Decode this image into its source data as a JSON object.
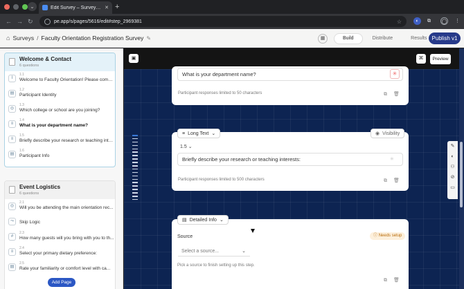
{
  "browser": {
    "tab_title": "Edit Survey – Survey Everywh",
    "tab_close": "✕",
    "new_tab": "+",
    "url": "pe.app/s/pages/5616/edit#step_2969381",
    "icons": {
      "back": "arrow-left-icon",
      "forward": "arrow-right-icon",
      "reload": "reload-icon",
      "star": "star-icon",
      "extensions": "puzzle-icon",
      "profile": "profile-icon",
      "menu": "more-vert-icon"
    }
  },
  "header": {
    "surveys_label": "Surveys",
    "separator": "/",
    "survey_title": "Faculty Orientation Registration Survey",
    "tabs": [
      {
        "label": "Build",
        "active": true
      },
      {
        "label": "Distribute",
        "active": false
      },
      {
        "label": "Results",
        "active": false
      }
    ],
    "publish_label": "Publish v1"
  },
  "sidebar": {
    "pages": [
      {
        "title": "Welcome & Contact",
        "count": "6 questions",
        "questions": [
          {
            "num": "1.1",
            "text": "Welcome to Faculty Orientation! Please comp...",
            "icon": "I"
          },
          {
            "num": "1.2",
            "text": "Participant Identity",
            "icon": "▤"
          },
          {
            "num": "1.3",
            "text": "Which college or school are you joining?",
            "icon": "◎"
          },
          {
            "num": "1.4",
            "text": "What is your department name?",
            "icon": "≡",
            "selected": true
          },
          {
            "num": "1.5",
            "text": "Briefly describe your research or teaching inte...",
            "icon": "≡"
          },
          {
            "num": "1.6",
            "text": "Participant Info",
            "icon": "▤"
          }
        ]
      },
      {
        "title": "Event Logistics",
        "count": "6 questions",
        "questions": [
          {
            "num": "2.1",
            "text": "Will you be attending the main orientation rec...",
            "icon": "◎"
          },
          {
            "text": "Skip Logic",
            "icon": "⤳"
          },
          {
            "num": "2.3",
            "text": "How many guests will you bring with you to th...",
            "icon": "#"
          },
          {
            "num": "2.4",
            "text": "Select your primary dietary preference:",
            "icon": "≡"
          },
          {
            "num": "2.5",
            "text": "Rate your familiarity or comfort level with ca...",
            "icon": "▤"
          }
        ]
      }
    ],
    "add_page": "Add Page"
  },
  "canvas": {
    "preview_label": "Preview",
    "card1": {
      "input_text": "What is your department name?",
      "hint": "Participant responses limited to 50 characters"
    },
    "card2": {
      "type_label": "Long Text",
      "visibility_label": "Visibility",
      "version": "1.5",
      "input_text": "Briefly describe your research or teaching interests:",
      "hint": "Participant responses limited to 500 characters"
    },
    "card3": {
      "type_label": "Detailed Info",
      "source_label": "Source",
      "needs_setup": "Needs setup",
      "select_placeholder": "Select a source...",
      "hint": "Pick a source to finish setting up this step."
    }
  }
}
